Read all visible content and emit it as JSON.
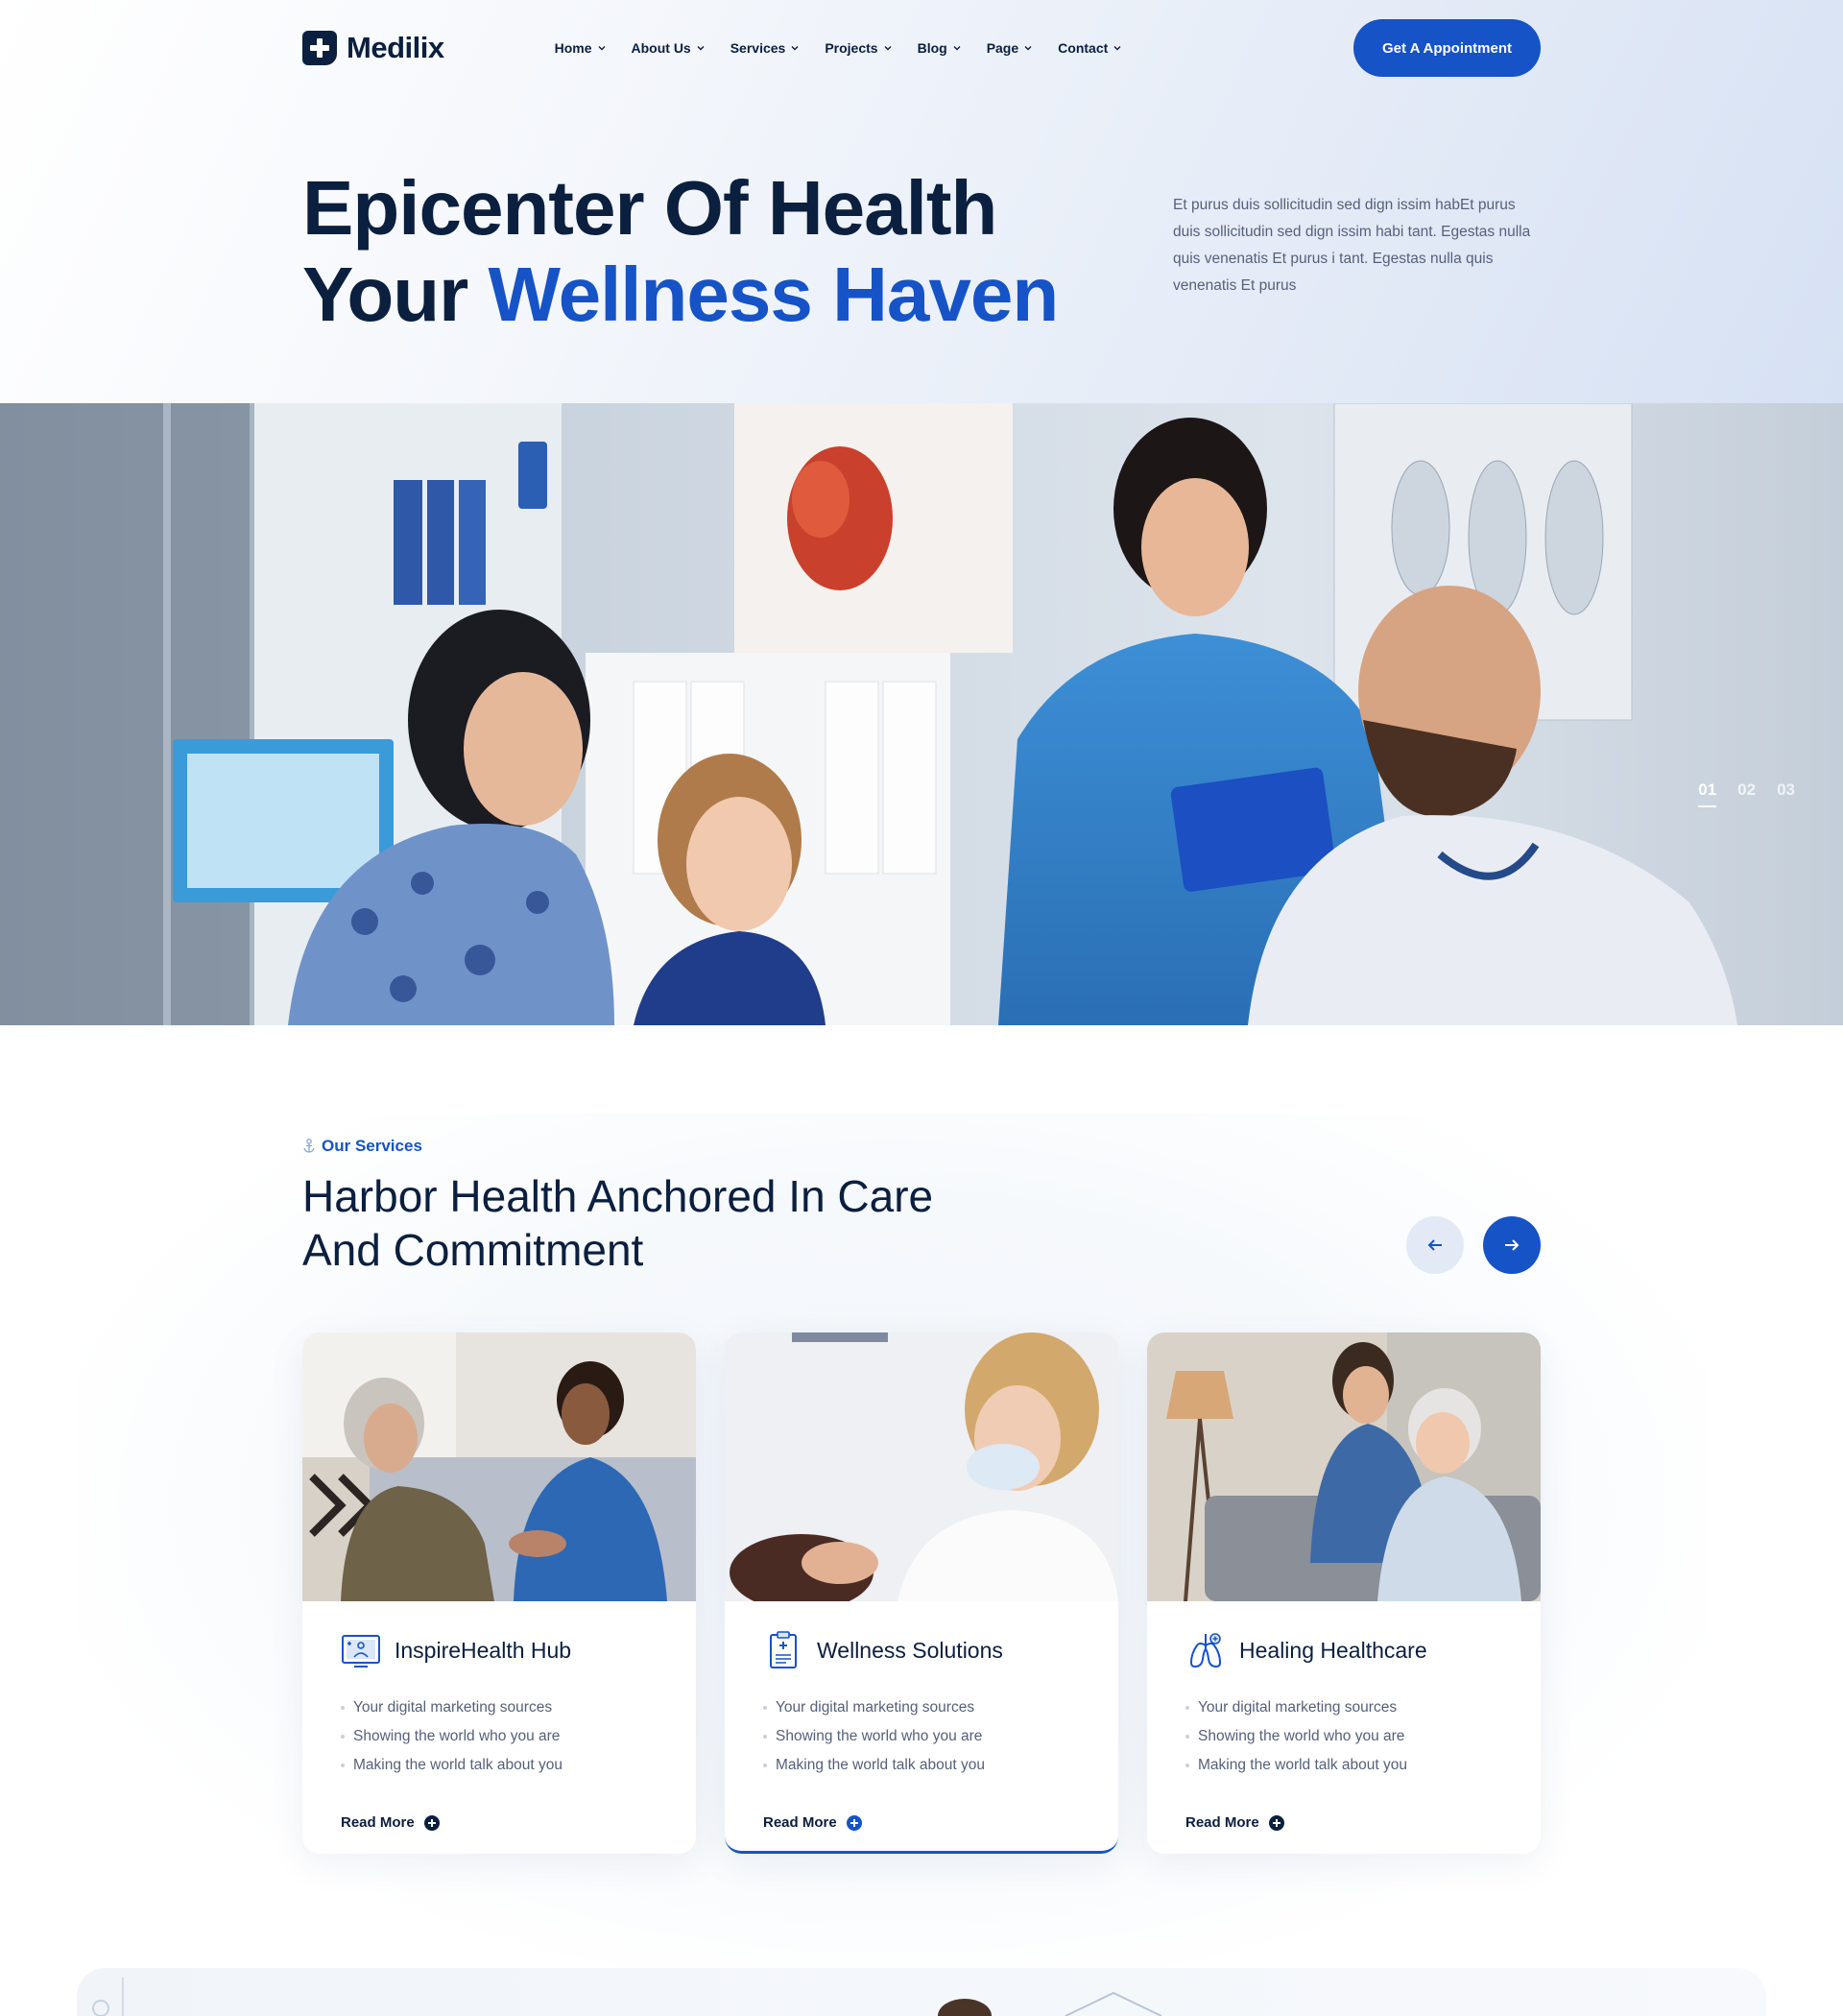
{
  "brand": {
    "name": "Medilix"
  },
  "nav": {
    "items": [
      {
        "label": "Home"
      },
      {
        "label": "About Us"
      },
      {
        "label": "Services"
      },
      {
        "label": "Projects"
      },
      {
        "label": "Blog"
      },
      {
        "label": "Page"
      },
      {
        "label": "Contact"
      }
    ],
    "cta_label": "Get A Appointment"
  },
  "hero": {
    "title_line1": "Epicenter Of Health",
    "title_line2_prefix": "Your ",
    "title_line2_accent": "Wellness Haven",
    "description": "Et purus duis sollicitudin sed dign issim habEt purus duis sollicitudin sed dign issim habi tant. Egestas nulla quis venenatis Et purus i tant. Egestas nulla quis venenatis Et purus",
    "slides": [
      {
        "label": "01",
        "active": true
      },
      {
        "label": "02",
        "active": false
      },
      {
        "label": "03",
        "active": false
      }
    ]
  },
  "services": {
    "tag": "Our Services",
    "title": "Harbor Health Anchored In Care And Commitment",
    "cards": [
      {
        "title": "InspireHealth Hub",
        "icon": "monitor-health-icon",
        "bullets": [
          "Your digital marketing sources",
          "Showing the world who you are",
          "Making the world talk about you"
        ],
        "link": "Read More"
      },
      {
        "title": "Wellness Solutions",
        "icon": "clipboard-medical-icon",
        "bullets": [
          "Your digital marketing sources",
          "Showing the world who you are",
          "Making the world talk about you"
        ],
        "link": "Read More"
      },
      {
        "title": "Healing Healthcare",
        "icon": "lungs-icon",
        "bullets": [
          "Your digital marketing sources",
          "Showing the world who you are",
          "Making the world talk about you"
        ],
        "link": "Read More"
      }
    ]
  },
  "colors": {
    "primary": "#1553c6",
    "dark": "#0b1f3f",
    "muted": "#56607a"
  }
}
